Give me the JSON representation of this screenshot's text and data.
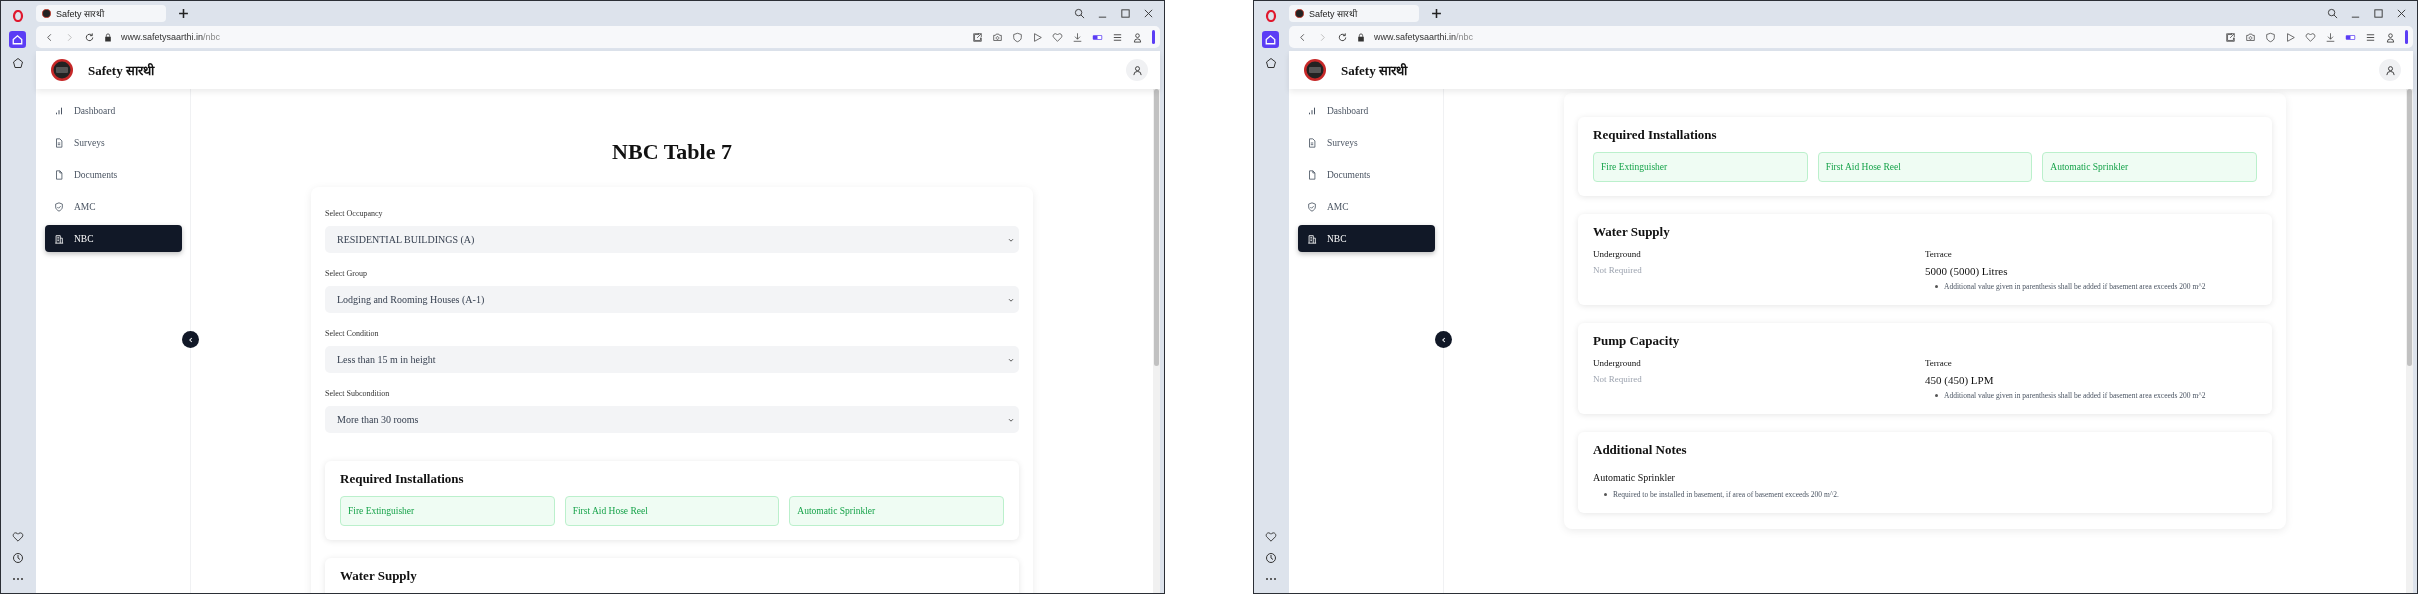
{
  "windows": [
    {
      "tab_title": "Safety सारथी",
      "url_host": "www.safetysaarthi.in",
      "url_path": "/nbc",
      "app_title": "Safety सारथी",
      "nav": [
        {
          "label": "Dashboard",
          "kind": "chart",
          "selected": false
        },
        {
          "label": "Surveys",
          "kind": "survey",
          "selected": false
        },
        {
          "label": "Documents",
          "kind": "document",
          "selected": false
        },
        {
          "label": "AMC",
          "kind": "shield",
          "selected": false
        },
        {
          "label": "NBC",
          "kind": "building",
          "selected": true
        }
      ],
      "page": {
        "title": "NBC Table 7",
        "selects": [
          {
            "label": "Select Occupancy",
            "value": "RESIDENTIAL BUILDINGS (A)"
          },
          {
            "label": "Select Group",
            "value": "Lodging and Rooming Houses (A-1)"
          },
          {
            "label": "Select Condition",
            "value": "Less than 15 m in height"
          },
          {
            "label": "Select Subcondition",
            "value": "More than 30 rooms"
          }
        ],
        "sections": [
          {
            "kind": "installations",
            "title": "Required Installations",
            "items": [
              "Fire Extinguisher",
              "First Aid Hose Reel",
              "Automatic Sprinkler"
            ]
          },
          {
            "kind": "quantity",
            "title": "Water Supply"
          }
        ]
      }
    },
    {
      "tab_title": "Safety सारथी",
      "url_host": "www.safetysaarthi.in",
      "url_path": "/nbc",
      "app_title": "Safety सारथी",
      "nav": [
        {
          "label": "Dashboard",
          "kind": "chart",
          "selected": false
        },
        {
          "label": "Surveys",
          "kind": "survey",
          "selected": false
        },
        {
          "label": "Documents",
          "kind": "document",
          "selected": false
        },
        {
          "label": "AMC",
          "kind": "shield",
          "selected": false
        },
        {
          "label": "NBC",
          "kind": "building",
          "selected": true
        }
      ],
      "page": {
        "sections": [
          {
            "kind": "installations",
            "title": "Required Installations",
            "items": [
              "Fire Extinguisher",
              "First Aid Hose Reel",
              "Automatic Sprinkler"
            ]
          },
          {
            "kind": "quantity",
            "title": "Water Supply",
            "columns": [
              {
                "label": "Underground",
                "value": "Not Required",
                "required": false
              },
              {
                "label": "Terrace",
                "value": "5000 (5000) Litres",
                "required": true,
                "notes": [
                  "Additional value given in parenthesis shall be added if basement area exceeds 200 m^2"
                ]
              }
            ]
          },
          {
            "kind": "quantity",
            "title": "Pump Capacity",
            "columns": [
              {
                "label": "Underground",
                "value": "Not Required",
                "required": false
              },
              {
                "label": "Terrace",
                "value": "450 (450) LPM",
                "required": true,
                "notes": [
                  "Additional value given in parenthesis shall be added if basement area exceeds 200 m^2"
                ]
              }
            ]
          },
          {
            "kind": "notes",
            "title": "Additional Notes",
            "items": [
              {
                "title": "Automatic Sprinkler",
                "notes": [
                  "Required to be installed in basement, if area of basement exceeds 200 m^2."
                ]
              }
            ]
          }
        ]
      }
    }
  ]
}
